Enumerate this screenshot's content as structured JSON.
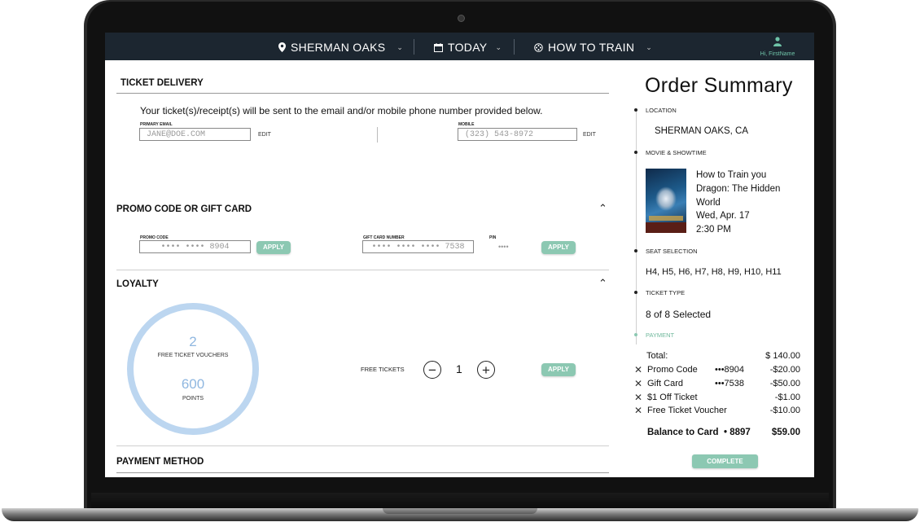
{
  "nav": {
    "location": "SHERMAN OAKS",
    "date": "TODAY",
    "movie": "HOW TO TRAIN",
    "user": "Hi, FirstName"
  },
  "ticket_delivery": {
    "heading": "TICKET DELIVERY",
    "description": "Your ticket(s)/receipt(s) will be sent to the email and/or mobile phone number provided below.",
    "email_label": "PRIMARY EMAIL",
    "email_value": "JANE@DOE.COM",
    "mobile_label": "MOBILE",
    "mobile_value": "(323) 543-8972",
    "edit_label": "EDIT"
  },
  "promo": {
    "heading": "PROMO CODE OR GIFT CARD",
    "promo_label": "PROMO CODE",
    "promo_value": "•••• •••• 8904",
    "gift_label": "GIFT CARD NUMBER",
    "gift_value": "•••• •••• •••• 7538",
    "pin_label": "PIN",
    "pin_value": "••••",
    "apply": "APPLY"
  },
  "loyalty": {
    "heading": "LOYALTY",
    "vouchers_count": "2",
    "vouchers_label": "FREE TICKET VOUCHERS",
    "points_count": "600",
    "points_label": "POINTS",
    "free_tickets_label": "FREE TICKETS",
    "quantity": "1",
    "apply": "APPLY"
  },
  "payment_method": {
    "heading": "PAYMENT METHOD"
  },
  "summary": {
    "title": "Order Summary",
    "location_label": "LOCATION",
    "location_value": "SHERMAN OAKS, CA",
    "movie_label": "MOVIE & SHOWTIME",
    "movie_line1": "How to Train you",
    "movie_line2": "Dragon: The Hidden",
    "movie_line3": "World",
    "movie_date": "Wed, Apr. 17",
    "movie_time": "2:30 PM",
    "seat_label": "SEAT SELECTION",
    "seat_value": "H4, H5, H6, H7, H8, H9, H10, H11",
    "ticket_type_label": "TICKET TYPE",
    "ticket_type_value": "8 of 8 Selected",
    "payment_label": "PAYMENT",
    "total_label": "Total:",
    "total_value": "$ 140.00",
    "items": [
      {
        "name": "Promo Code",
        "ref": "•••8904",
        "amount": "-$20.00"
      },
      {
        "name": "Gift Card",
        "ref": "•••7538",
        "amount": "-$50.00"
      },
      {
        "name": "$1 Off Ticket",
        "ref": "",
        "amount": "-$1.00"
      },
      {
        "name": "Free Ticket Voucher",
        "ref": "",
        "amount": "-$10.00"
      }
    ],
    "balance_label": "Balance to Card",
    "balance_ref": "• 8897",
    "balance_value": "$59.00",
    "complete": "COMPLETE"
  },
  "colors": {
    "nav_bg": "#1c2630",
    "accent": "#8cc8b2",
    "loyalty_ring": "#bcd6f0"
  }
}
